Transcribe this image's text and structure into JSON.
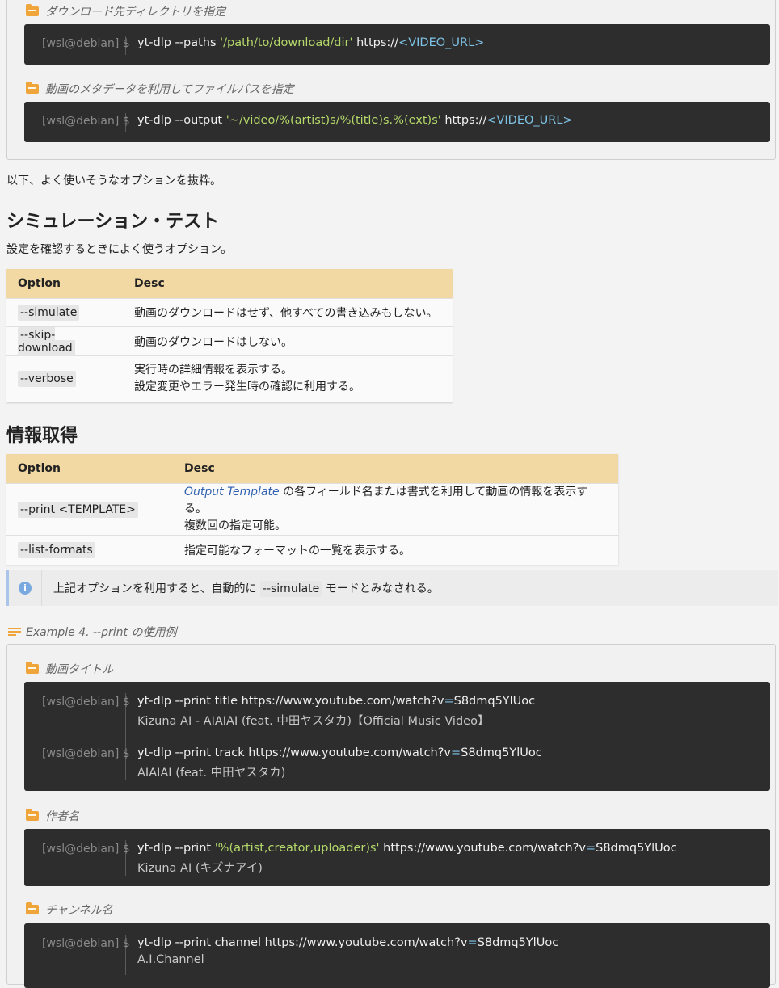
{
  "ex_top": {
    "cap1": "ダウンロード先ディレクトリを指定",
    "cap2": "動画のメタデータを利用してファイルパスを指定",
    "prompt": "[wsl@debian] $",
    "cmd1_pre": "yt-dlp --paths ",
    "cmd1_str": "'/path/to/download/dir'",
    "cmd1_post": " https://",
    "cmd1_url": "<VIDEO_URL>",
    "cmd2_pre": "yt-dlp --output ",
    "cmd2_str": "'~/video/%(artist)s/%(title)s.%(ext)s'",
    "cmd2_post": " https://",
    "cmd2_url": "<VIDEO_URL>"
  },
  "intro": "以下、よく使いそうなオプションを抜粋。",
  "sim": {
    "heading": "シミュレーション・テスト",
    "desc": "設定を確認するときによく使うオプション。",
    "col_option": "Option",
    "col_desc": "Desc",
    "rows": [
      {
        "opt": "--simulate",
        "desc": "動画のダウンロードはせず、他すべての書き込みもしない。"
      },
      {
        "opt": "--skip-download",
        "desc": "動画のダウンロードはしない。"
      },
      {
        "opt": "--verbose",
        "desc1": "実行時の詳細情報を表示する。",
        "desc2": "設定変更やエラー発生時の確認に利用する。"
      }
    ]
  },
  "info": {
    "heading": "情報取得",
    "col_option": "Option",
    "col_desc": "Desc",
    "row1_opt": "--print <TEMPLATE>",
    "row1_link": "Output Template",
    "row1_desc": " の各フィールド名または書式を利用して動画の情報を表示する。",
    "row1_desc2": "複数回の指定可能。",
    "row2_opt": "--list-formats",
    "row2_desc": "指定可能なフォーマットの一覧を表示する。"
  },
  "note": {
    "icon": "i",
    "pre": "上記オプションを利用すると、自動的に ",
    "code": "--simulate",
    "post": " モードとみなされる。"
  },
  "example4": {
    "caption": "Example 4. --print の使用例",
    "cap_title": "動画タイトル",
    "cap_author": "作者名",
    "cap_channel": "チャンネル名",
    "prompt": "[wsl@debian] $",
    "t1_cmd": "yt-dlp --print title https://www.youtube.com/watch?v",
    "t1_eq": "=",
    "t1_id": "S8dmq5YlUoc",
    "t1_out": "Kizuna AI - AIAIAI (feat. 中田ヤスタカ)【Official Music Video】",
    "t2_cmd": "yt-dlp --print track https://www.youtube.com/watch?v",
    "t2_eq": "=",
    "t2_id": "S8dmq5YlUoc",
    "t2_out": "AIAIAI (feat. 中田ヤスタカ)",
    "a_pre": "yt-dlp --print ",
    "a_str": "'%(artist,creator,uploader)s'",
    "a_post": " https://www.youtube.com/watch?v",
    "a_eq": "=",
    "a_id": "S8dmq5YlUoc",
    "a_out": "Kizuna AI (キズナアイ)",
    "c_cmd": "yt-dlp --print channel https://www.youtube.com/watch?v",
    "c_eq": "=",
    "c_id": "S8dmq5YlUoc",
    "c_out": "A.I.Channel"
  }
}
